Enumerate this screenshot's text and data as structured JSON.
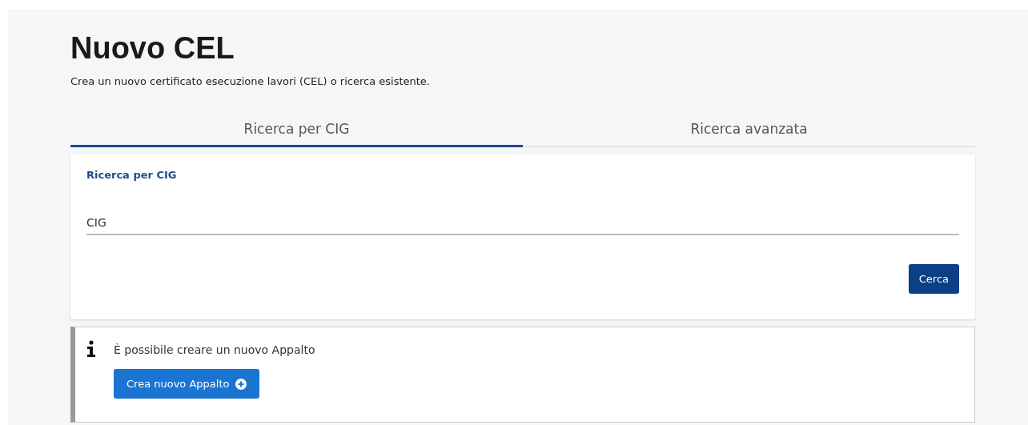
{
  "page": {
    "title": "Nuovo CEL",
    "subtitle": "Crea un nuovo certificato esecuzione lavori (CEL) o ricerca esistente."
  },
  "tabs": [
    {
      "label": "Ricerca per CIG",
      "selected": true
    },
    {
      "label": "Ricerca avanzata",
      "selected": false
    }
  ],
  "search_card": {
    "title": "Ricerca per CIG",
    "field": {
      "placeholder": "CIG"
    },
    "button": "Cerca"
  },
  "info": {
    "message": "È possibile creare un nuovo Appalto",
    "button": "Crea nuovo Appalto"
  }
}
